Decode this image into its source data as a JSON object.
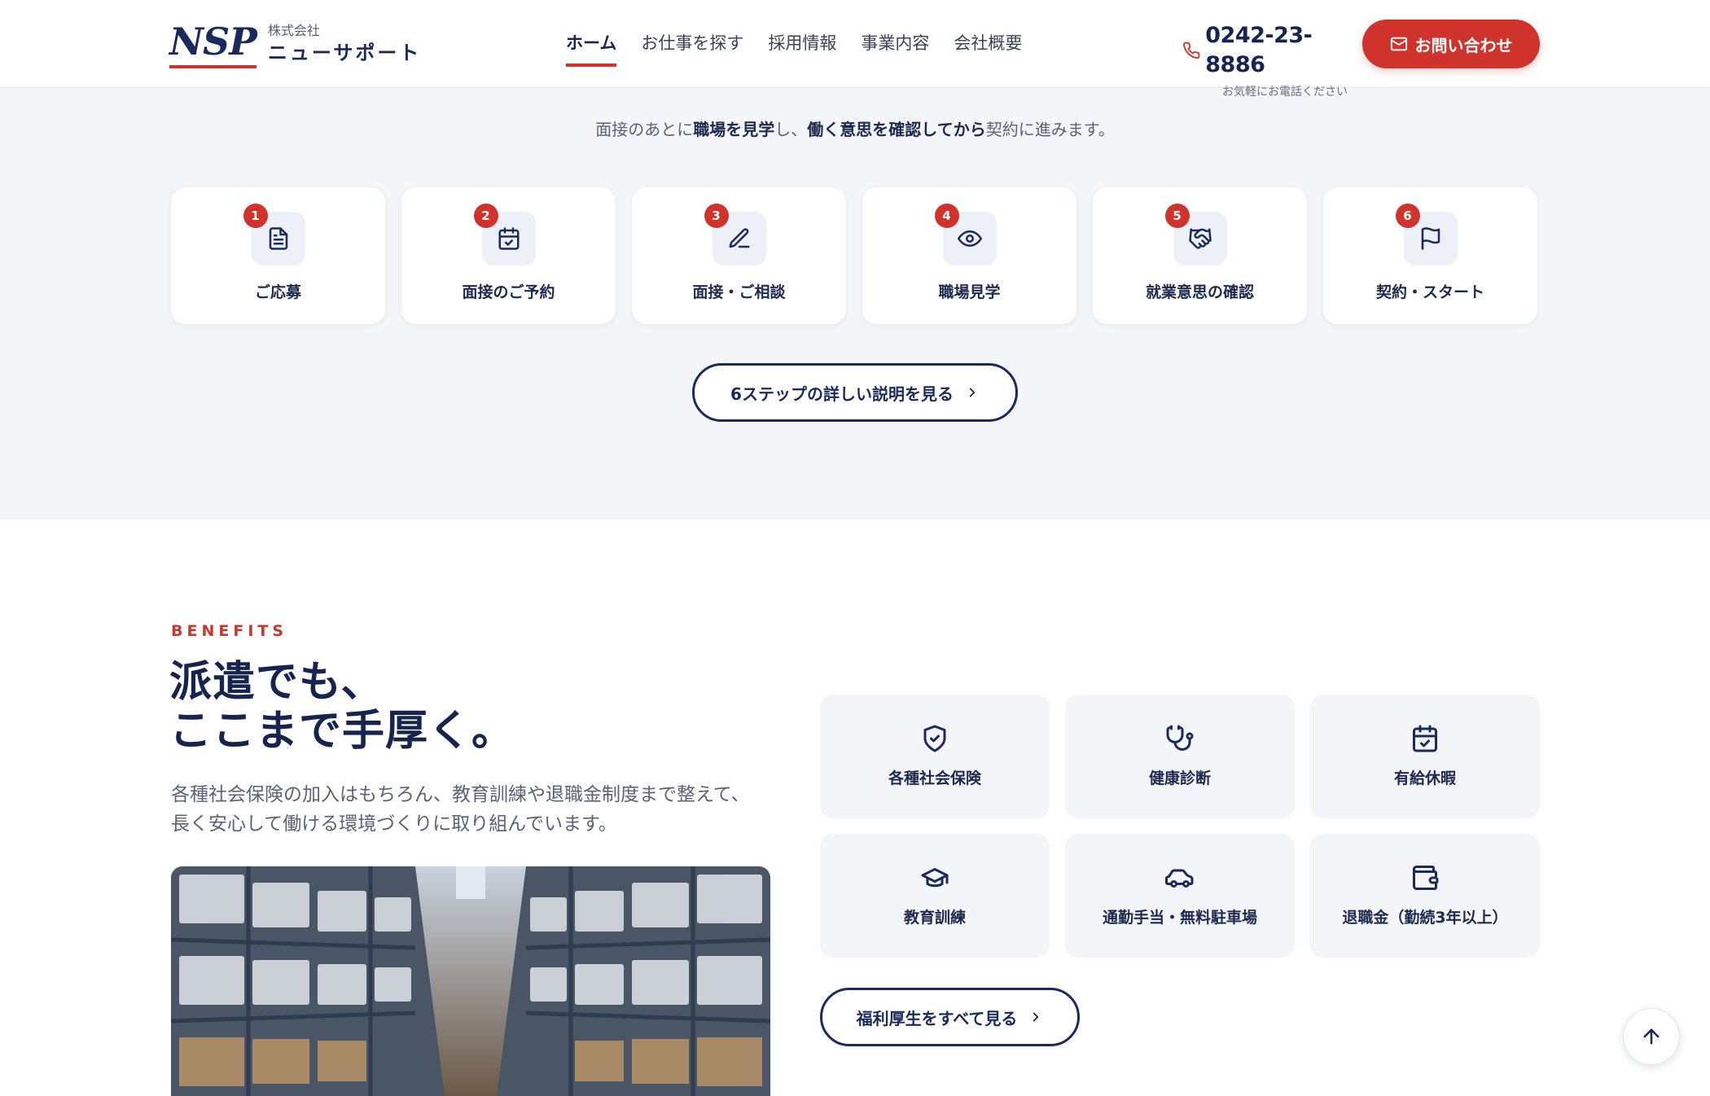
{
  "header": {
    "logo_mark": "NSP",
    "logo_small": "株式会社",
    "logo_name": "ニューサポート",
    "nav": [
      {
        "label": "ホーム"
      },
      {
        "label": "お仕事を探す"
      },
      {
        "label": "採用情報"
      },
      {
        "label": "事業内容"
      },
      {
        "label": "会社概要"
      }
    ],
    "phone": "0242-23-8886",
    "phone_note": "お気軽にお電話ください",
    "contact_label": "お問い合わせ"
  },
  "steps": {
    "intro_1": "面接のあとに",
    "intro_2": "職場を見学",
    "intro_3": "し、",
    "intro_4": "働く意思を確認してから",
    "intro_5": "契約に進みます。",
    "items": [
      {
        "num": "1",
        "label": "ご応募",
        "icon": "document-icon"
      },
      {
        "num": "2",
        "label": "面接のご予約",
        "icon": "calendar-check-icon"
      },
      {
        "num": "3",
        "label": "面接・ご相談",
        "icon": "pen-icon"
      },
      {
        "num": "4",
        "label": "職場見学",
        "icon": "eye-icon"
      },
      {
        "num": "5",
        "label": "就業意思の確認",
        "icon": "handshake-icon"
      },
      {
        "num": "6",
        "label": "契約・スタート",
        "icon": "flag-icon"
      }
    ],
    "more_label": "6ステップの詳しい説明を見る"
  },
  "benefits": {
    "eyebrow": "BENEFITS",
    "title_line1": "派遣でも、",
    "title_line2": "ここまで手厚く。",
    "description": "各種社会保険の加入はもちろん、教育訓練や退職金制度まで整えて、 長く安心して働ける環境づくりに取り組んでいます。",
    "items": [
      {
        "label": "各種社会保険",
        "icon": "shield-check-icon"
      },
      {
        "label": "健康診断",
        "icon": "stethoscope-icon"
      },
      {
        "label": "有給休暇",
        "icon": "calendar-check-icon"
      },
      {
        "label": "教育訓練",
        "icon": "graduation-cap-icon"
      },
      {
        "label": "通勤手当・無料駐車場",
        "icon": "car-icon"
      },
      {
        "label": "退職金（勤続3年以上）",
        "icon": "wallet-icon"
      }
    ],
    "more_label": "福利厚生をすべて見る"
  },
  "colors": {
    "accent": "#d0332b",
    "navy": "#1b2a5a",
    "section_bg": "#f4f5f9"
  }
}
